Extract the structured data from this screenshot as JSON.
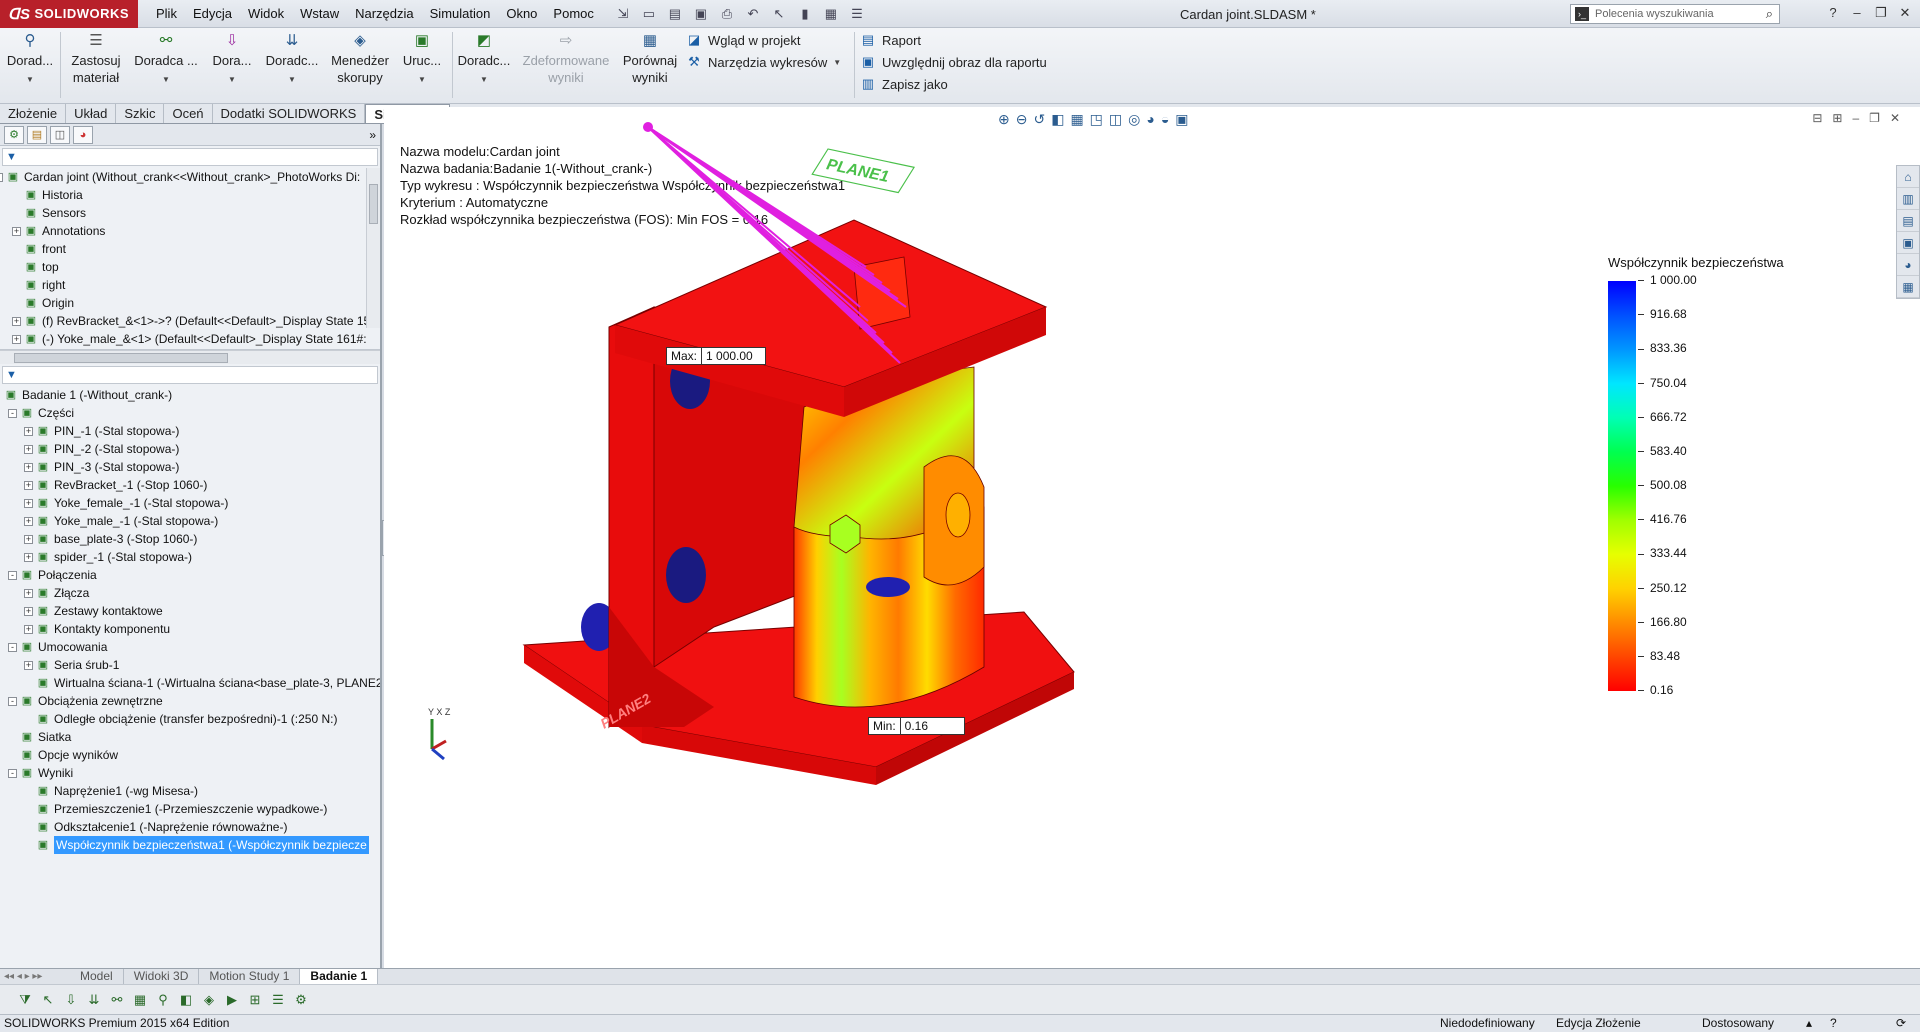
{
  "app": {
    "brand": "SOLIDWORKS",
    "document_title": "Cardan joint.SLDASM *",
    "menu": [
      "Plik",
      "Edycja",
      "Widok",
      "Wstaw",
      "Narzędzia",
      "Simulation",
      "Okno",
      "Pomoc"
    ],
    "search_placeholder": "Polecenia wyszukiwania"
  },
  "ribbon": {
    "doradca1": "Dorad...",
    "zastosuj_line1": "Zastosuj",
    "zastosuj_line2": "materiał",
    "doradca2": "Doradca ...",
    "doradca3": "Dora...",
    "doradca4": "Doradc...",
    "menedzer_line1": "Menedżer",
    "menedzer_line2": "skorupy",
    "uruchom": "Uruc...",
    "doradca5": "Doradc...",
    "zdeformowane_line1": "Zdeformowane",
    "zdeformowane_line2": "wyniki",
    "porownaj_line1": "Porównaj",
    "porownaj_line2": "wyniki",
    "wglad": "Wgląd w projekt",
    "narzedzia": "Narzędzia wykresów",
    "raport": "Raport",
    "uwzglednij": "Uwzględnij obraz dla raportu",
    "zapisz": "Zapisz jako"
  },
  "cm_tabs": [
    "Złożenie",
    "Układ",
    "Szkic",
    "Oceń",
    "Dodatki SOLIDWORKS",
    "Simulation"
  ],
  "cm_active": "Simulation",
  "feature_tree": [
    {
      "label": "Cardan joint  (Without_crank<<Without_crank>_PhotoWorks Di:",
      "level": 0,
      "exp": "-"
    },
    {
      "label": "Historia",
      "level": 1,
      "exp": ""
    },
    {
      "label": "Sensors",
      "level": 1,
      "exp": ""
    },
    {
      "label": "Annotations",
      "level": 1,
      "exp": "+"
    },
    {
      "label": "front",
      "level": 1,
      "exp": ""
    },
    {
      "label": "top",
      "level": 1,
      "exp": ""
    },
    {
      "label": "right",
      "level": 1,
      "exp": ""
    },
    {
      "label": "Origin",
      "level": 1,
      "exp": ""
    },
    {
      "label": "(f) RevBracket_&<1>->? (Default<<Default>_Display State 15",
      "level": 1,
      "exp": "+"
    },
    {
      "label": "(-) Yoke_male_&<1> (Default<<Default>_Display State 161#:",
      "level": 1,
      "exp": "+"
    }
  ],
  "sim_tree": [
    {
      "label": "Badanie 1 (-Without_crank-)",
      "level": 0,
      "exp": ""
    },
    {
      "label": "Części",
      "level": 1,
      "exp": "-"
    },
    {
      "label": "PIN_-1 (-Stal stopowa-)",
      "level": 2,
      "exp": "+"
    },
    {
      "label": "PIN_-2 (-Stal stopowa-)",
      "level": 2,
      "exp": "+"
    },
    {
      "label": "PIN_-3 (-Stal stopowa-)",
      "level": 2,
      "exp": "+"
    },
    {
      "label": "RevBracket_-1 (-Stop 1060-)",
      "level": 2,
      "exp": "+"
    },
    {
      "label": "Yoke_female_-1 (-Stal stopowa-)",
      "level": 2,
      "exp": "+"
    },
    {
      "label": "Yoke_male_-1 (-Stal stopowa-)",
      "level": 2,
      "exp": "+"
    },
    {
      "label": "base_plate-3 (-Stop 1060-)",
      "level": 2,
      "exp": "+"
    },
    {
      "label": "spider_-1 (-Stal stopowa-)",
      "level": 2,
      "exp": "+"
    },
    {
      "label": "Połączenia",
      "level": 1,
      "exp": "-"
    },
    {
      "label": "Złącza",
      "level": 2,
      "exp": "+"
    },
    {
      "label": "Zestawy kontaktowe",
      "level": 2,
      "exp": "+"
    },
    {
      "label": "Kontakty komponentu",
      "level": 2,
      "exp": "+"
    },
    {
      "label": "Umocowania",
      "level": 1,
      "exp": "-"
    },
    {
      "label": "Seria śrub-1",
      "level": 2,
      "exp": "+"
    },
    {
      "label": "Wirtualna ściana-1 (-Wirtualna ściana<base_plate-3, PLANE2",
      "level": 2,
      "exp": ""
    },
    {
      "label": "Obciążenia zewnętrzne",
      "level": 1,
      "exp": "-"
    },
    {
      "label": "Odległe obciążenie (transfer bezpośredni)-1 (:250 N:)",
      "level": 2,
      "exp": ""
    },
    {
      "label": "Siatka",
      "level": 1,
      "exp": ""
    },
    {
      "label": "Opcje wyników",
      "level": 1,
      "exp": ""
    },
    {
      "label": "Wyniki",
      "level": 1,
      "exp": "-"
    },
    {
      "label": "Naprężenie1 (-wg Misesa-)",
      "level": 2,
      "exp": ""
    },
    {
      "label": "Przemieszczenie1 (-Przemieszczenie wypadkowe-)",
      "level": 2,
      "exp": ""
    },
    {
      "label": "Odkształcenie1 (-Naprężenie równoważne-)",
      "level": 2,
      "exp": ""
    },
    {
      "label": "Współczynnik bezpieczeństwa1 (-Współczynnik bezpiecze",
      "level": 2,
      "exp": "",
      "selected": true
    }
  ],
  "bottom_tabs": [
    "Model",
    "Widoki 3D",
    "Motion Study 1",
    "Badanie 1"
  ],
  "bottom_active": "Badanie 1",
  "plot_info": {
    "model": "Nazwa modelu:Cardan joint",
    "study": "Nazwa badania:Badanie 1(-Without_crank-)",
    "plot_type": "Typ wykresu : Współczynnik bezpieczeństwa Współczynnik bezpieczeństwa1",
    "criterion": "Kryterium : Automatyczne",
    "distribution": "Rozkład współczynnika bezpieczeństwa (FOS): Min FOS = 0.16"
  },
  "legend": {
    "title": "Współczynnik bezpieczeństwa",
    "values": [
      "1 000.00",
      "916.68",
      "833.36",
      "750.04",
      "666.72",
      "583.40",
      "500.08",
      "416.76",
      "333.44",
      "250.12",
      "166.80",
      "83.48",
      "0.16"
    ],
    "colors": [
      "#0000ff",
      "#0050ff",
      "#0096ff",
      "#00e6ff",
      "#00ffb4",
      "#00ff50",
      "#28ff00",
      "#a0ff00",
      "#e6ff00",
      "#ffd200",
      "#ff8c00",
      "#ff4600",
      "#ff0000"
    ]
  },
  "probes": {
    "max_label": "Max:",
    "max_value": "1 000.00",
    "min_label": "Min:",
    "min_value": "0.16"
  },
  "model_labels": {
    "plane1": "PLANE1",
    "plane2": "PLANE2",
    "triad": "Y X Z"
  },
  "status": {
    "edition": "SOLIDWORKS Premium 2015 x64 Edition",
    "definition": "Niedodefiniowany",
    "mode": "Edycja Złożenie",
    "units": "Dostosowany"
  }
}
